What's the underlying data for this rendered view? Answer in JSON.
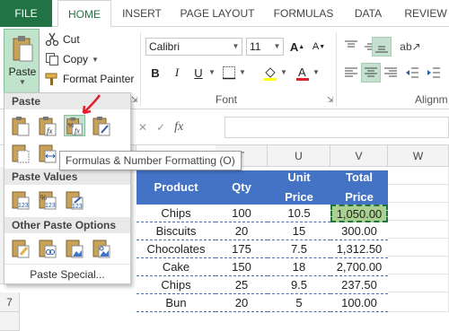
{
  "tabs": [
    {
      "label": "FILE"
    },
    {
      "label": "HOME"
    },
    {
      "label": "INSERT"
    },
    {
      "label": "PAGE LAYOUT"
    },
    {
      "label": "FORMULAS"
    },
    {
      "label": "DATA"
    },
    {
      "label": "REVIEW"
    }
  ],
  "clipboard": {
    "paste_label": "Paste",
    "cut_label": "Cut",
    "copy_label": "Copy",
    "format_painter_label": "Format Painter"
  },
  "font": {
    "name": "Calibri",
    "size": "11",
    "group_label": "Font",
    "bold": "B",
    "italic": "I",
    "underline": "U",
    "grow": "A",
    "shrink": "A"
  },
  "alignment": {
    "group_label": "Alignm"
  },
  "formula_bar": {
    "fx": "fx",
    "cancel": "✕",
    "enter": "✓"
  },
  "columns": [
    "T",
    "U",
    "V",
    "W"
  ],
  "row_numbers": [
    "7"
  ],
  "table": {
    "headers": [
      "Product",
      "Qty",
      "Unit Price",
      "Total Price"
    ],
    "rows": [
      [
        "Chips",
        "100",
        "10.5",
        "1,050.00"
      ],
      [
        "Biscuits",
        "20",
        "15",
        "300.00"
      ],
      [
        "Chocolates",
        "175",
        "7.5",
        "1,312.50"
      ],
      [
        "Cake",
        "150",
        "18",
        "2,700.00"
      ],
      [
        "Chips",
        "25",
        "9.5",
        "237.50"
      ],
      [
        "Bun",
        "20",
        "5",
        "100.00"
      ]
    ]
  },
  "paste_menu": {
    "section_paste": "Paste",
    "section_values": "Paste Values",
    "section_other": "Other Paste Options",
    "paste_special": "Paste Special...",
    "tooltip": "Formulas & Number Formatting (O)"
  },
  "colors": {
    "accent": "#217346",
    "table_header": "#4472c4",
    "selected_cell": "#a9d08e",
    "highlight": "#c5e0cf",
    "arrow": "#e0202c"
  }
}
